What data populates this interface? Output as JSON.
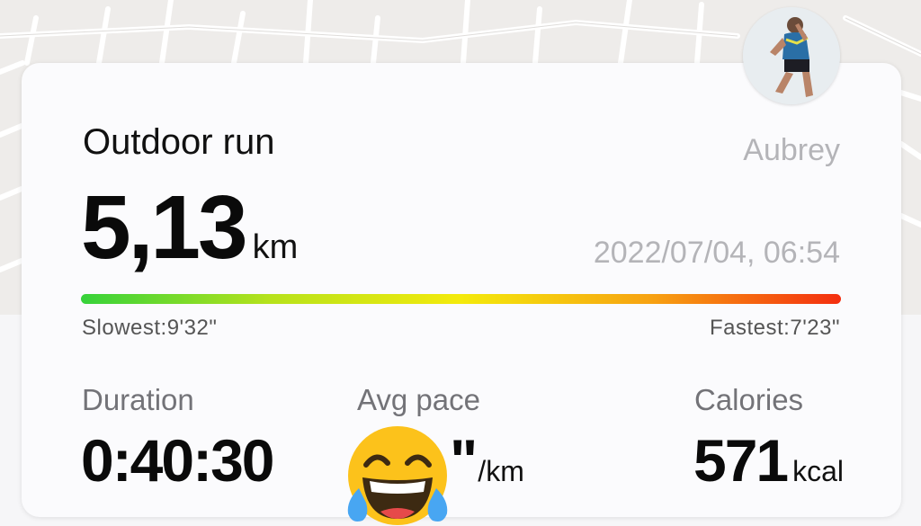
{
  "activity": {
    "title": "Outdoor run",
    "user": "Aubrey",
    "distance_value": "5,13",
    "distance_unit": "km",
    "datetime": "2022/07/04, 06:54"
  },
  "pace_scale": {
    "slowest": "Slowest:9'32\"",
    "fastest": "Fastest:7'23\""
  },
  "stats": {
    "duration_label": "Duration",
    "duration_value": "0:40:30",
    "pace_label": "Avg pace",
    "pace_value": "\"",
    "pace_unit": "/km",
    "calories_label": "Calories",
    "calories_value": "571",
    "calories_unit": "kcal"
  },
  "icons": {
    "avatar": "avatar-photo",
    "overlay": "laughing-tears-emoji"
  },
  "colors": {
    "pace_gradient": [
      "#36d23a",
      "#f4ea0c",
      "#f42e0f"
    ]
  }
}
